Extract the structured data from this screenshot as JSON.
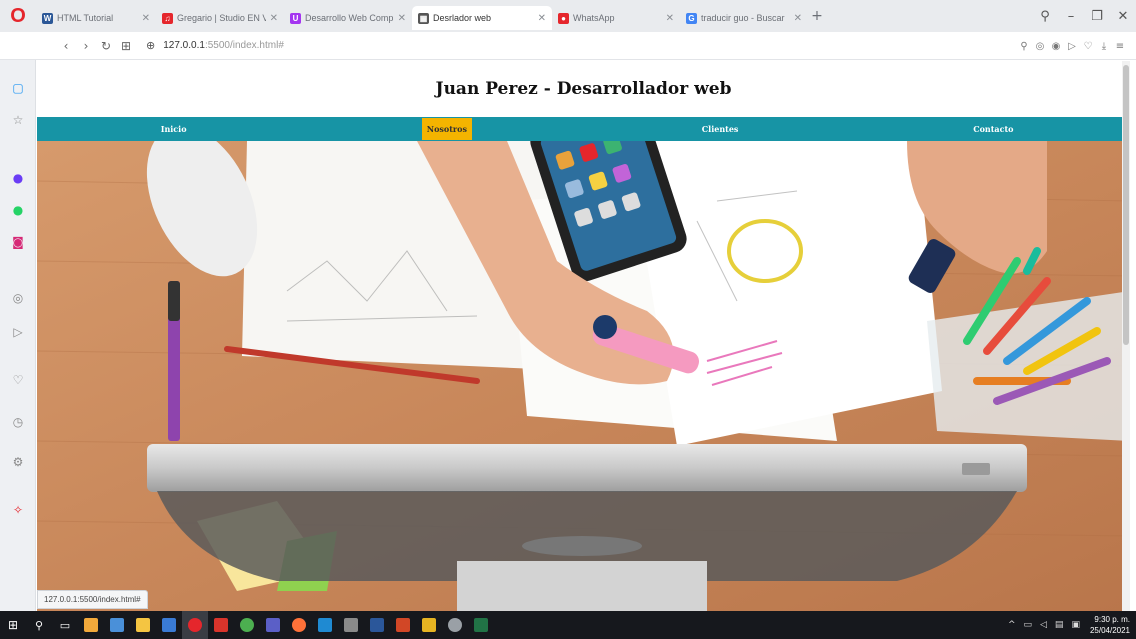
{
  "browser": {
    "logo": "O",
    "tabs": [
      {
        "title": "HTML Tutorial",
        "favicon": "W",
        "color": "#2b5797"
      },
      {
        "title": "Gregario | Studio EN VI",
        "favicon": "♫",
        "color": "#e5262c"
      },
      {
        "title": "Desarrollo Web Compl",
        "favicon": "U",
        "color": "#a435f0"
      },
      {
        "title": "Desrlador web",
        "favicon": "▦",
        "color": "#555555"
      },
      {
        "title": "WhatsApp",
        "favicon": "●",
        "color": "#e5262c"
      },
      {
        "title": "traducir guo - Buscar",
        "favicon": "G",
        "color": "#4285f4"
      }
    ],
    "active_tab": 3,
    "url_host": "127.0.0.1",
    "url_path": ":5500/index.html#",
    "status_url": "127.0.0.1:5500/index.html#"
  },
  "page": {
    "title": "Juan Perez - Desarrollador web",
    "menu": [
      {
        "label": "Inicio",
        "active": false
      },
      {
        "label": "Nosotros",
        "active": true
      },
      {
        "label": "Clientes",
        "active": false
      },
      {
        "label": "Contacto",
        "active": false
      }
    ]
  },
  "sidebar": {
    "icons": [
      {
        "name": "workspace-icon",
        "glyph": "▢",
        "color": "#2196f3"
      },
      {
        "name": "star-icon",
        "glyph": "☆",
        "color": "#888888"
      },
      {
        "name": "messenger-icon",
        "glyph": "●",
        "color": "#6a3df5"
      },
      {
        "name": "whatsapp-icon",
        "glyph": "●",
        "color": "#25d366"
      },
      {
        "name": "instagram-icon",
        "glyph": "◙",
        "color": "#d62976"
      },
      {
        "name": "player-icon",
        "glyph": "◎",
        "color": "#888888"
      },
      {
        "name": "send-icon",
        "glyph": "▷",
        "color": "#888888"
      },
      {
        "name": "heart-icon",
        "glyph": "♡",
        "color": "#888888"
      },
      {
        "name": "history-icon",
        "glyph": "◷",
        "color": "#888888"
      },
      {
        "name": "settings-icon",
        "glyph": "⚙",
        "color": "#888888"
      },
      {
        "name": "extensions-icon",
        "glyph": "✧",
        "color": "#e5262c"
      }
    ],
    "more": "···"
  },
  "taskbar": {
    "time": "9:30 p. m.",
    "date": "25/04/2021"
  }
}
